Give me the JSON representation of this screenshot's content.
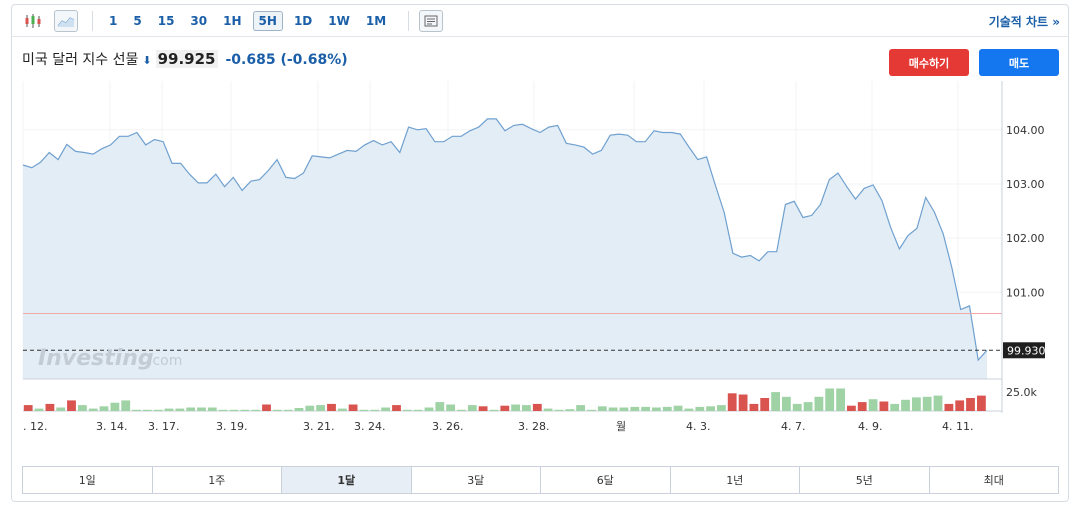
{
  "toolbar": {
    "icons": [
      "candlestick-icon",
      "area-chart-icon",
      "indicators-icon"
    ],
    "timeframes": [
      "1",
      "5",
      "15",
      "30",
      "1H",
      "5H",
      "1D",
      "1W",
      "1M"
    ],
    "active_timeframe": "5H",
    "advanced_chart_label": "기술적 차트 »"
  },
  "header": {
    "instrument": "미국 달러 지수 선물",
    "price": "99.925",
    "change": "-0.685 (-0.68%)",
    "buy_label": "매수하기",
    "sell_label": "매도"
  },
  "watermark": {
    "brand": "Investing",
    "suffix": ".com"
  },
  "range_tabs": [
    "1일",
    "1주",
    "1달",
    "3달",
    "6달",
    "1년",
    "5년",
    "최대"
  ],
  "active_range": "1달",
  "colors": {
    "line": "#6fa0cf",
    "area": "#e3edf6",
    "accent": "#1a5fa8",
    "buy": "#e53935",
    "sell": "#1477f0",
    "volume_up": "#9fd3a6",
    "volume_down": "#d9534f",
    "reference_line": "#f2a8a8"
  },
  "chart_data": {
    "type": "area",
    "x": [
      0,
      1,
      2,
      3,
      4,
      5,
      6,
      7,
      8,
      9,
      10,
      11,
      12,
      13,
      14,
      15,
      16,
      17,
      18,
      19,
      20,
      21,
      22,
      23,
      24,
      25,
      26,
      27,
      28,
      29,
      30,
      31,
      32,
      33,
      34,
      35,
      36,
      37,
      38,
      39,
      40,
      41,
      42,
      43,
      44,
      45,
      46,
      47,
      48,
      49,
      50,
      51,
      52,
      53,
      54,
      55,
      56,
      57,
      58,
      59,
      60,
      61,
      62,
      63,
      64,
      65,
      66,
      67,
      68,
      69,
      70,
      71,
      72,
      73,
      74,
      75,
      76,
      77,
      78,
      79,
      80,
      81,
      82,
      83,
      84,
      85,
      86,
      87,
      88,
      89,
      90,
      91,
      92,
      93,
      94,
      95,
      96,
      97,
      98,
      99,
      100,
      101,
      102,
      103,
      104,
      105,
      106,
      107,
      108,
      109,
      110,
      111,
      112,
      113,
      114,
      115,
      116,
      117,
      118,
      119,
      120,
      121,
      122,
      123,
      124,
      125,
      126,
      127,
      128,
      129,
      130,
      131,
      132,
      133,
      134,
      135,
      136,
      137,
      138,
      139,
      140,
      141,
      142,
      143,
      144,
      145,
      146,
      147,
      148,
      149,
      150,
      151,
      152,
      153,
      154,
      155,
      156,
      157,
      158,
      159,
      160
    ],
    "values": [
      103.35,
      103.3,
      103.4,
      103.58,
      103.45,
      103.73,
      103.6,
      103.58,
      103.55,
      103.65,
      103.72,
      103.88,
      103.88,
      103.95,
      103.72,
      103.82,
      103.78,
      103.38,
      103.38,
      103.18,
      103.02,
      103.02,
      103.18,
      102.95,
      103.12,
      102.88,
      103.05,
      103.08,
      103.25,
      103.45,
      103.12,
      103.1,
      103.2,
      103.52,
      103.5,
      103.48,
      103.55,
      103.62,
      103.6,
      103.72,
      103.8,
      103.72,
      103.78,
      103.58,
      104.05,
      104.0,
      104.02,
      103.78,
      103.78,
      103.88,
      103.88,
      103.98,
      104.05,
      104.2,
      104.2,
      103.98,
      104.08,
      104.1,
      104.02,
      103.95,
      104.05,
      104.08,
      103.75,
      103.72,
      103.68,
      103.55,
      103.62,
      103.9,
      103.92,
      103.9,
      103.78,
      103.78,
      103.98,
      103.95,
      103.95,
      103.92,
      103.68,
      103.45,
      103.5,
      102.98,
      102.48,
      101.72,
      101.65,
      101.68,
      101.58,
      101.75,
      101.75,
      102.62,
      102.68,
      102.38,
      102.42,
      102.62,
      103.08,
      103.2,
      102.95,
      102.72,
      102.92,
      102.98,
      102.7,
      102.2,
      101.8,
      102.05,
      102.18,
      102.75,
      102.48,
      102.08,
      101.45,
      100.68,
      100.75,
      99.75,
      99.93
    ],
    "x_ticks": [
      ". 12.",
      "3. 14.",
      "3. 17.",
      "3. 19.",
      "3. 21.",
      "3. 24.",
      "3. 26.",
      "3. 28.",
      "월",
      "4. 3.",
      "4. 7.",
      "4. 9.",
      "4. 11."
    ],
    "y_ticks": [
      "104.00",
      "103.00",
      "102.00",
      "101.00"
    ],
    "ylim": [
      99.4,
      104.9
    ],
    "reference_level": 100.61,
    "last_price_label": "99.930",
    "last_price": 99.93,
    "volume_label": "25.0k",
    "volume": [
      0.5,
      0.2,
      0.6,
      0.3,
      0.9,
      0.5,
      0.2,
      0.4,
      0.7,
      0.9,
      0.1,
      0.1,
      0.1,
      0.2,
      0.2,
      0.3,
      0.3,
      0.3,
      0.1,
      0.1,
      0.1,
      0.1,
      0.55,
      0.1,
      0.1,
      0.25,
      0.45,
      0.5,
      0.6,
      0.2,
      0.55,
      0.1,
      0.1,
      0.3,
      0.5,
      0.1,
      0.1,
      0.3,
      0.75,
      0.55,
      0.1,
      0.5,
      0.4,
      0.1,
      0.45,
      0.55,
      0.5,
      0.6,
      0.2,
      0.1,
      0.15,
      0.5,
      0.1,
      0.4,
      0.3,
      0.3,
      0.35,
      0.35,
      0.3,
      0.35,
      0.45,
      0.2,
      0.35,
      0.4,
      0.5,
      1.5,
      1.4,
      0.6,
      1.1,
      1.6,
      1.2,
      0.6,
      0.75,
      1.2,
      1.9,
      1.9,
      0.45,
      0.75,
      1.0,
      0.8,
      0.6,
      0.95,
      1.15,
      1.2,
      1.3,
      0.6,
      0.9,
      1.1,
      1.3
    ],
    "volume_colors": [
      "d",
      "u",
      "d",
      "u",
      "d",
      "u",
      "u",
      "u",
      "u",
      "u",
      "u",
      "u",
      "u",
      "u",
      "u",
      "u",
      "u",
      "u",
      "u",
      "u",
      "u",
      "u",
      "d",
      "u",
      "u",
      "u",
      "u",
      "u",
      "d",
      "u",
      "d",
      "u",
      "u",
      "u",
      "d",
      "u",
      "u",
      "u",
      "u",
      "u",
      "u",
      "u",
      "d",
      "u",
      "d",
      "u",
      "u",
      "d",
      "u",
      "u",
      "u",
      "u",
      "u",
      "u",
      "u",
      "u",
      "u",
      "u",
      "u",
      "u",
      "u",
      "u",
      "u",
      "u",
      "u",
      "d",
      "d",
      "d",
      "d",
      "u",
      "u",
      "u",
      "u",
      "u",
      "u",
      "u",
      "d",
      "d",
      "u",
      "d",
      "u",
      "u",
      "u",
      "u",
      "u",
      "d",
      "d",
      "d",
      "d"
    ]
  }
}
